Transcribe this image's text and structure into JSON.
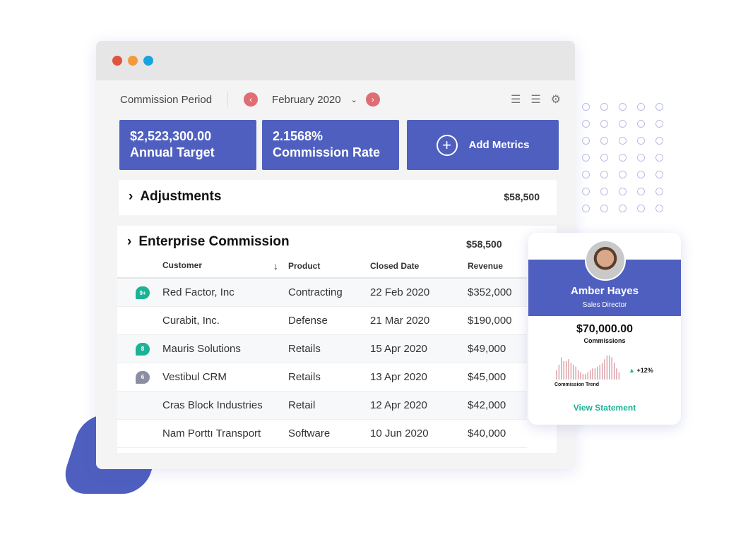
{
  "window": {
    "controls": [
      {
        "color": "#e0533d"
      },
      {
        "color": "#f39a3c"
      },
      {
        "color": "#1aa3dc"
      }
    ]
  },
  "header": {
    "label": "Commission Period",
    "period": "February 2020",
    "prev_icon": "chevron-left-icon",
    "next_icon": "chevron-right-icon",
    "icons": [
      "sort-list-icon",
      "sort-order-icon",
      "gear-icon"
    ]
  },
  "metrics": [
    {
      "value": "$2,523,300.00",
      "label": "Annual Target"
    },
    {
      "value": "2.1568%",
      "label": "Commission Rate"
    }
  ],
  "add_metrics": "Add Metrics",
  "adjustments": {
    "title": "Adjustments",
    "amount": "$58,500"
  },
  "enterprise": {
    "title": "Enterprise Commission",
    "amount": "$58,500",
    "columns": [
      "Customer",
      "Product",
      "Closed Date",
      "Revenue"
    ],
    "rows": [
      {
        "badge": "9+",
        "badge_color": "#1ab394",
        "customer": "Red Factor, Inc",
        "product": "Contracting",
        "date": "22 Feb 2020",
        "revenue": "$352,000"
      },
      {
        "badge": "",
        "customer": "Curabit, Inc.",
        "product": "Defense",
        "date": "21 Mar 2020",
        "revenue": "$190,000"
      },
      {
        "badge": "8",
        "badge_color": "#1ab394",
        "customer": "Mauris Solutions",
        "product": "Retails",
        "date": "15 Apr 2020",
        "revenue": "$49,000"
      },
      {
        "badge": "6",
        "badge_color": "#8a8fa3",
        "customer": "Vestibul CRM",
        "product": "Retails",
        "date": "13 Apr 2020",
        "revenue": "$45,000"
      },
      {
        "badge": "",
        "customer": "Cras Block Industries",
        "product": "Retail",
        "date": "12 Apr 2020",
        "revenue": "$42,000"
      },
      {
        "badge": "",
        "customer": "Nam Porttı Transport",
        "product": "Software",
        "date": "10 Jun 2020",
        "revenue": "$40,000"
      }
    ]
  },
  "profile": {
    "name": "Amber Hayes",
    "role": "Sales Director",
    "amount": "$70,000.00",
    "amount_label": "Commissions",
    "trend_label": "Commission Trend",
    "trend": "+12%",
    "trend_values": [
      5,
      8,
      12,
      10,
      10,
      11,
      9,
      8,
      7,
      5,
      4,
      3,
      3,
      4,
      5,
      6,
      6,
      7,
      8,
      9,
      11,
      13,
      13,
      12,
      9,
      6,
      4
    ],
    "link": "View Statement"
  }
}
